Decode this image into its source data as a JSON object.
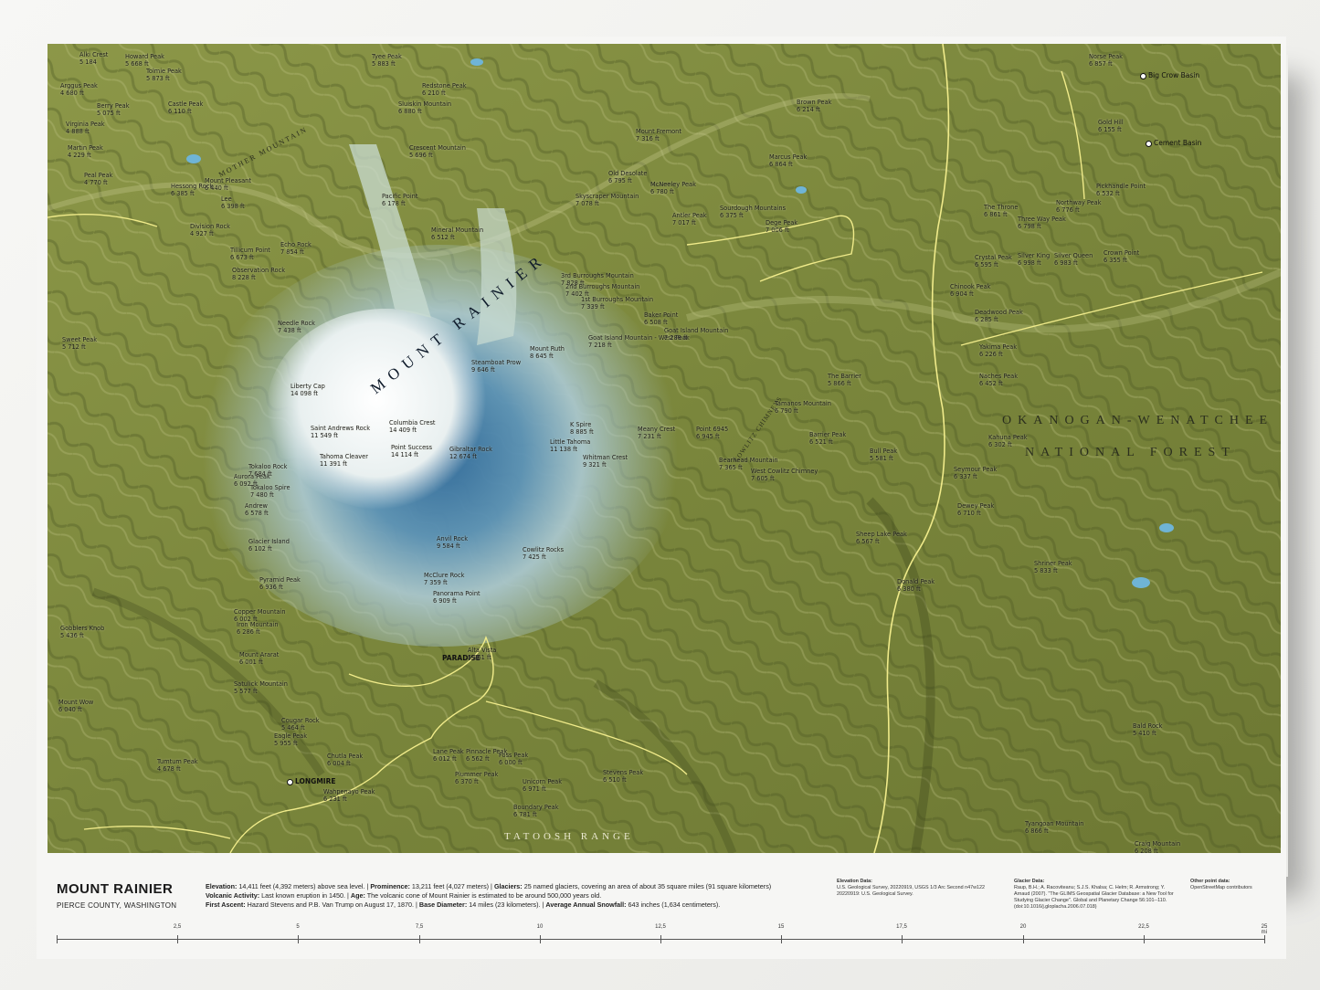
{
  "map": {
    "title": "MOUNT RAINIER",
    "subtitle": "PIERCE COUNTY, WASHINGTON",
    "colors": {
      "terrain_low": "#7d8a3e",
      "terrain_mid": "#a5ae63",
      "terrain_shadow": "#3f4a1d",
      "glacier_blue": "#3f7fb0",
      "glacier_white": "#eef4f6",
      "road": "#f0eb8a",
      "water": "#6fb4d6"
    },
    "region_labels": {
      "rainier": "MOUNT RAINIER",
      "forest_line1": "OKANOGAN-WENATCHEE",
      "forest_line2": "NATIONAL FOREST",
      "tatoosh": "TATOOSH RANGE",
      "mother_mountain": "MOTHER MOUNTAIN",
      "cowlitz": "COWLITZ CHIMNEYS"
    },
    "towns": [
      {
        "name": "PARADISE"
      },
      {
        "name": "LONGMIRE"
      },
      {
        "name": "Big Crow Basin"
      },
      {
        "name": "Cement Basin"
      }
    ],
    "peaks": [
      {
        "name": "Alki Crest",
        "elev": "5 184"
      },
      {
        "name": "Howard Peak",
        "elev": "5 668 ft"
      },
      {
        "name": "Tolmie Peak",
        "elev": "5 873 ft"
      },
      {
        "name": "Arggus Peak",
        "elev": "4 680 ft"
      },
      {
        "name": "Berry Peak",
        "elev": "5 075 ft"
      },
      {
        "name": "Castle Peak",
        "elev": "6 110 ft"
      },
      {
        "name": "Virginia Peak",
        "elev": "4 888 ft"
      },
      {
        "name": "Martin Peak",
        "elev": "4 229 ft"
      },
      {
        "name": "Peal Peak",
        "elev": "4 770 ft"
      },
      {
        "name": "Hessong Rock",
        "elev": "6 385 ft"
      },
      {
        "name": "Mount Pleasant",
        "elev": "6 440 ft"
      },
      {
        "name": "Lee",
        "elev": "6 398 ft"
      },
      {
        "name": "Division Rock",
        "elev": "4 927 ft"
      },
      {
        "name": "Tillicum Point",
        "elev": "6 673 ft"
      },
      {
        "name": "Echo Rock",
        "elev": "7 854 ft"
      },
      {
        "name": "Observation Rock",
        "elev": "8 228 ft"
      },
      {
        "name": "Sweet Peak",
        "elev": "5 712 ft"
      },
      {
        "name": "Needle Rock",
        "elev": "7 438 ft"
      },
      {
        "name": "Liberty Cap",
        "elev": "14 098 ft"
      },
      {
        "name": "Columbia Crest",
        "elev": "14 409 ft"
      },
      {
        "name": "Point Success",
        "elev": "14 114 ft"
      },
      {
        "name": "Saint Andrews Rock",
        "elev": "11 549 ft"
      },
      {
        "name": "Tahoma Cleaver",
        "elev": "11 391 ft"
      },
      {
        "name": "Tokaloo Rock",
        "elev": "7 684 ft"
      },
      {
        "name": "Tokaloo Spire",
        "elev": "7 480 ft"
      },
      {
        "name": "Aurora Peak",
        "elev": "6 092 ft"
      },
      {
        "name": "Andrew",
        "elev": "6 578 ft"
      },
      {
        "name": "Glacier Island",
        "elev": "6 102 ft"
      },
      {
        "name": "Pyramid Peak",
        "elev": "6 936 ft"
      },
      {
        "name": "Copper Mountain",
        "elev": "6 002 ft"
      },
      {
        "name": "Iron Mountain",
        "elev": "6 286 ft"
      },
      {
        "name": "Gobblers Knob",
        "elev": "5 436 ft"
      },
      {
        "name": "Mount Ararat",
        "elev": "6 001 ft"
      },
      {
        "name": "Satulick Mountain",
        "elev": "5 577 ft"
      },
      {
        "name": "Mount Wow",
        "elev": "6 040 ft"
      },
      {
        "name": "Cougar Rock",
        "elev": "5 464 ft"
      },
      {
        "name": "Tumtum Peak",
        "elev": "4 678 ft"
      },
      {
        "name": "Eagle Peak",
        "elev": "5 955 ft"
      },
      {
        "name": "Chutla Peak",
        "elev": "6 004 ft"
      },
      {
        "name": "Wahpenayo Peak",
        "elev": "6 231 ft"
      },
      {
        "name": "Lane Peak",
        "elev": "6 012 ft"
      },
      {
        "name": "Pinnacle Peak",
        "elev": "6 562 ft"
      },
      {
        "name": "Plummer Peak",
        "elev": "6 370 ft"
      },
      {
        "name": "Foss Peak",
        "elev": "6 000 ft"
      },
      {
        "name": "Unicorn Peak",
        "elev": "6 971 ft"
      },
      {
        "name": "Stevens Peak",
        "elev": "6 510 ft"
      },
      {
        "name": "Boundary Peak",
        "elev": "6 781 ft"
      },
      {
        "name": "Alta Vista",
        "elev": "5 961 ft"
      },
      {
        "name": "Panorama Point",
        "elev": "6 909 ft"
      },
      {
        "name": "McClure Rock",
        "elev": "7 359 ft"
      },
      {
        "name": "Anvil Rock",
        "elev": "9 584 ft"
      },
      {
        "name": "Gibraltar Rock",
        "elev": "12 674 ft"
      },
      {
        "name": "Cowlitz Rocks",
        "elev": "7 425 ft"
      },
      {
        "name": "Little Tahoma",
        "elev": "11 138 ft"
      },
      {
        "name": "Whitman Crest",
        "elev": "9 321 ft"
      },
      {
        "name": "K Spire",
        "elev": "8 885 ft"
      },
      {
        "name": "Steamboat Prow",
        "elev": "9 646 ft"
      },
      {
        "name": "Mount Ruth",
        "elev": "8 645 ft"
      },
      {
        "name": "Goat Island Mountain - West Peak",
        "elev": "7 218 ft"
      },
      {
        "name": "Baker Point",
        "elev": "6 508 ft"
      },
      {
        "name": "Goat Island Mountain",
        "elev": "7 288 ft"
      },
      {
        "name": "3rd Burroughs Mountain",
        "elev": "7 828 ft"
      },
      {
        "name": "2nd Burroughs Mountain",
        "elev": "7 402 ft"
      },
      {
        "name": "1st Burroughs Mountain",
        "elev": "7 339 ft"
      },
      {
        "name": "Mineral Mountain",
        "elev": "6 512 ft"
      },
      {
        "name": "Skyscraper Mountain",
        "elev": "7 078 ft"
      },
      {
        "name": "Mount Fremont",
        "elev": "7 316 ft"
      },
      {
        "name": "Old Desolate",
        "elev": "6 795 ft"
      },
      {
        "name": "Pacific Point",
        "elev": "6 178 ft"
      },
      {
        "name": "Crescent Mountain",
        "elev": "5 696 ft"
      },
      {
        "name": "Sluiskin Mountain",
        "elev": "6 880 ft"
      },
      {
        "name": "Redstone Peak",
        "elev": "6 210 ft"
      },
      {
        "name": "Tyee Peak",
        "elev": "5 883 ft"
      },
      {
        "name": "Brown Peak",
        "elev": "6 214 ft"
      },
      {
        "name": "Marcus Peak",
        "elev": "6 864 ft"
      },
      {
        "name": "McNeeley Peak",
        "elev": "6 780 ft"
      },
      {
        "name": "Antler Peak",
        "elev": "7 017 ft"
      },
      {
        "name": "Sourdough Mountains",
        "elev": "6 375 ft"
      },
      {
        "name": "Dege Peak",
        "elev": "7 006 ft"
      },
      {
        "name": "Meany Crest",
        "elev": "7 231 ft"
      },
      {
        "name": "Point 6945",
        "elev": "6 945 ft"
      },
      {
        "name": "Tamanos Mountain",
        "elev": "6 790 ft"
      },
      {
        "name": "Barrier Peak",
        "elev": "6 521 ft"
      },
      {
        "name": "The Barrier",
        "elev": "5 866 ft"
      },
      {
        "name": "Bull Peak",
        "elev": "5 581 ft"
      },
      {
        "name": "Bearhead Mountain",
        "elev": "7 365 ft"
      },
      {
        "name": "West Cowlitz Chimney",
        "elev": "7 605 ft"
      },
      {
        "name": "Dewey Peak",
        "elev": "6 710 ft"
      },
      {
        "name": "Seymour Peak",
        "elev": "6 337 ft"
      },
      {
        "name": "Naches Peak",
        "elev": "6 452 ft"
      },
      {
        "name": "Yakima Peak",
        "elev": "6 226 ft"
      },
      {
        "name": "Deadwood Peak",
        "elev": "6 285 ft"
      },
      {
        "name": "Chinook Peak",
        "elev": "6 904 ft"
      },
      {
        "name": "Crystal Peak",
        "elev": "6 595 ft"
      },
      {
        "name": "Silver King",
        "elev": "6 998 ft"
      },
      {
        "name": "Three Way Peak",
        "elev": "6 798 ft"
      },
      {
        "name": "The Throne",
        "elev": "6 861 ft"
      },
      {
        "name": "Silver Queen",
        "elev": "6 983 ft"
      },
      {
        "name": "Northway Peak",
        "elev": "6 776 ft"
      },
      {
        "name": "Crown Point",
        "elev": "6 355 ft"
      },
      {
        "name": "Pickhandle Point",
        "elev": "6 532 ft"
      },
      {
        "name": "Gold Hill",
        "elev": "6 155 ft"
      },
      {
        "name": "Norse Peak",
        "elev": "6 857 ft"
      },
      {
        "name": "Kahuna Peak",
        "elev": "6 302 ft"
      },
      {
        "name": "Sheep Lake Peak",
        "elev": "6 567 ft"
      },
      {
        "name": "Donald Peak",
        "elev": "6 380 ft"
      },
      {
        "name": "Shriner Peak",
        "elev": "5 833 ft"
      },
      {
        "name": "Bald Rock",
        "elev": "5 410 ft"
      },
      {
        "name": "Craig Mountain",
        "elev": "6 208 ft"
      },
      {
        "name": "Tyangoan Mountain",
        "elev": "6 866 ft"
      }
    ],
    "peaks_visible_note": ""
  },
  "footer": {
    "elevation_label": "Elevation:",
    "elevation_text": "14,411 feet (4,392 meters) above sea level.",
    "prominence_label": "Prominence:",
    "prominence_text": "13,211 feet (4,027 meters)",
    "glaciers_label": "Glaciers:",
    "glaciers_text": "25 named glaciers, covering an area of about 35 square miles (91 square kilometers)",
    "volcanic_label": "Volcanic Activity:",
    "volcanic_text": "Last known eruption in 1450.",
    "age_label": "Age:",
    "age_text": "The volcanic cone of Mount Rainier is estimated to be around 500,000 years old.",
    "ascent_label": "First Ascent:",
    "ascent_text": "Hazard Stevens and P.B. Van Trump on August 17, 1870.",
    "base_label": "Base Diameter:",
    "base_text": "14 miles (23 kilometers).",
    "snow_label": "Average Annual Snowfall:",
    "snow_text": "643 inches (1,634 centimeters).",
    "credits": {
      "elevation_title": "Elevation Data:",
      "elevation_body": "U.S. Geological Survey, 20220919, USGS 1/3 Arc Second n47w122 20220919: U.S. Geological Survey.",
      "glacier_title": "Glacier Data:",
      "glacier_body": "Raup, B.H.; A. Racoviteanu; S.J.S. Khalsa; C. Helm; R. Armstrong; Y. Arnaud (2007). \"The GLIMS Geospatial Glacier Database: a New Tool for Studying Glacier Change\". Global and Planetary Change 56:101--110. (doi:10.1016/j.gloplacha.2006.07.018)",
      "other_title": "Other point data:",
      "other_body": "OpenStreetMap contributors"
    }
  },
  "scale": {
    "ticks": [
      "2,5",
      "5",
      "7,5",
      "10",
      "12,5",
      "15",
      "17,5",
      "20",
      "22,5",
      "25 mi"
    ]
  }
}
